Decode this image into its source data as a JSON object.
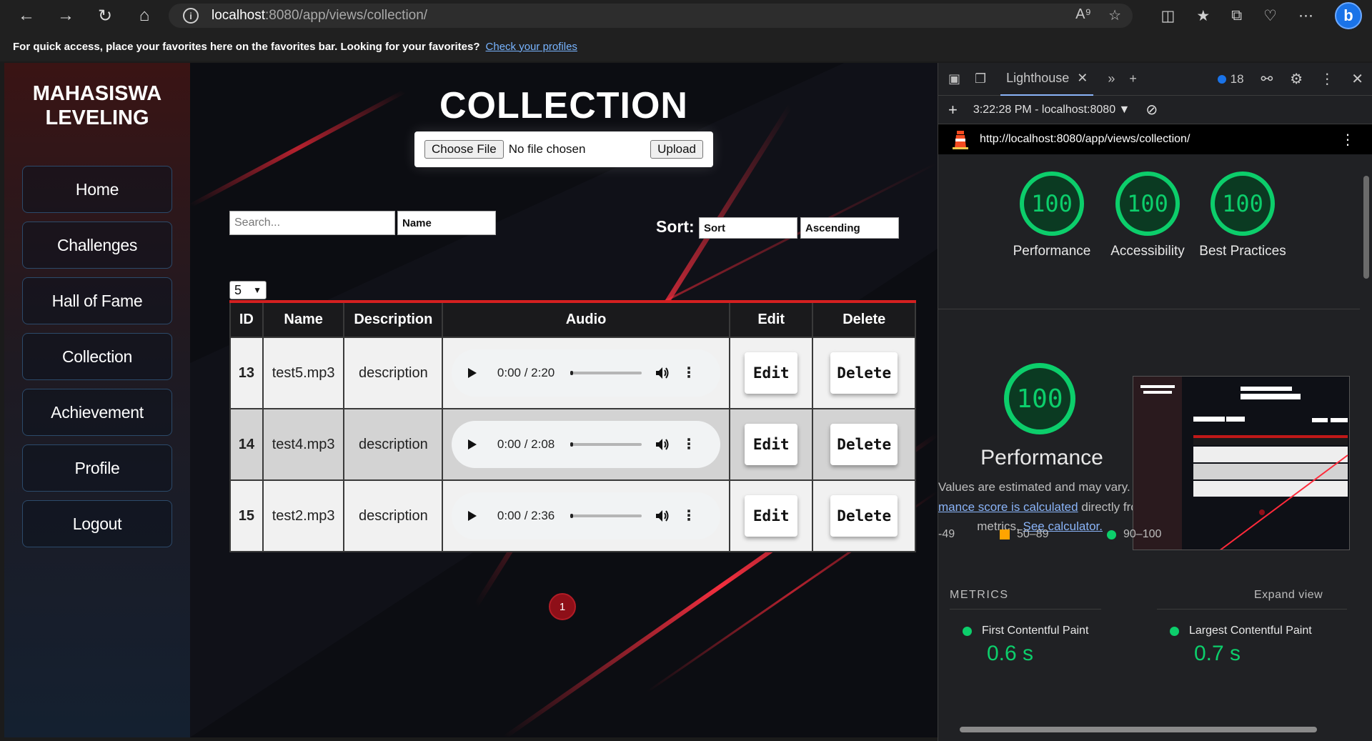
{
  "browser": {
    "url_host": "localhost",
    "url_path": ":8080/app/views/collection/",
    "favorites_message": "For quick access, place your favorites here on the favorites bar. Looking for your favorites?",
    "favorites_link": "Check your profiles",
    "bing_label": "b"
  },
  "sidebar": {
    "brand_line1": "MAHASISWA",
    "brand_line2": "LEVELING",
    "items": [
      {
        "label": "Home"
      },
      {
        "label": "Challenges"
      },
      {
        "label": "Hall of Fame"
      },
      {
        "label": "Collection"
      },
      {
        "label": "Achievement"
      },
      {
        "label": "Profile"
      },
      {
        "label": "Logout"
      }
    ]
  },
  "main": {
    "title": "COLLECTION",
    "upload": {
      "choose_label": "Choose File",
      "status": "No file chosen",
      "upload_label": "Upload"
    },
    "search_placeholder": "Search...",
    "filter_value": "Name",
    "sort_label": "Sort:",
    "sort_field": "Sort",
    "sort_order": "Ascending",
    "page_size": "5",
    "table": {
      "headers": [
        "ID",
        "Name",
        "Description",
        "Audio",
        "Edit",
        "Delete"
      ],
      "rows": [
        {
          "id": "13",
          "name": "test5.mp3",
          "description": "description",
          "time": "0:00 / 2:20",
          "edit": "Edit",
          "delete": "Delete"
        },
        {
          "id": "14",
          "name": "test4.mp3",
          "description": "description",
          "time": "0:00 / 2:08",
          "edit": "Edit",
          "delete": "Delete"
        },
        {
          "id": "15",
          "name": "test2.mp3",
          "description": "description",
          "time": "0:00 / 2:36",
          "edit": "Edit",
          "delete": "Delete"
        }
      ]
    },
    "current_page": "1"
  },
  "devtools": {
    "tab_label": "Lighthouse",
    "issues_count": "18",
    "report_time": "3:22:28 PM - localhost:8080",
    "report_url": "http://localhost:8080/app/views/collection/",
    "scores": [
      {
        "value": "100",
        "label": "Performance"
      },
      {
        "value": "100",
        "label": "Accessibility"
      },
      {
        "value": "100",
        "label": "Best Practices"
      }
    ],
    "perf_score": "100",
    "perf_title": "Performance",
    "perf_desc_1": "Values are estimated and may vary. The",
    "perf_desc_link": "mance score is calculated",
    "perf_desc_2": "directly from",
    "perf_desc_3": "metrics.",
    "perf_desc_link2": "See calculator.",
    "legend": [
      "-49",
      "50–89",
      "90–100"
    ],
    "metrics_heading": "METRICS",
    "expand_view": "Expand view",
    "metrics": [
      {
        "label": "First Contentful Paint",
        "value": "0.6 s"
      },
      {
        "label": "Largest Contentful Paint",
        "value": "0.7 s"
      }
    ]
  },
  "colors": {
    "accent_red": "#d42020",
    "score_green": "#0cce6b",
    "average_orange": "#ffa400"
  }
}
